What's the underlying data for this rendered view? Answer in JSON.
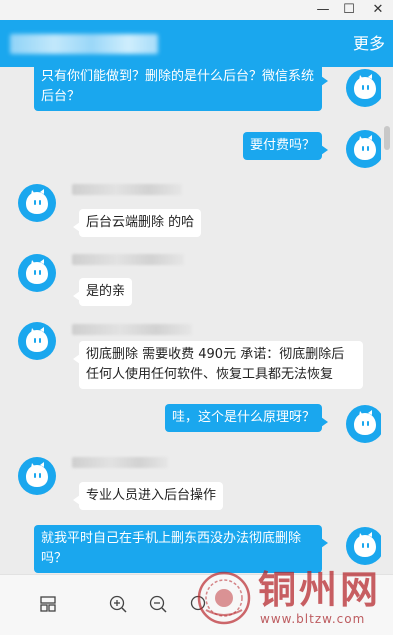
{
  "window": {
    "minimize": "—",
    "maximize": "☐",
    "close": "✕"
  },
  "header": {
    "more_label": "更多"
  },
  "messages": [
    {
      "side": "out",
      "text": "只有你们能做到？删除的是什么后台？微信系统后台？"
    },
    {
      "side": "out",
      "text": "要付费吗？"
    },
    {
      "side": "in",
      "text": "后台云端删除 的哈"
    },
    {
      "side": "in",
      "text": "是的亲"
    },
    {
      "side": "in",
      "text": "彻底删除 需要收费 490元 承诺：彻底删除后任何人使用任何软件、恢复工具都无法恢复"
    },
    {
      "side": "out",
      "text": "哇，这个是什么原理呀？"
    },
    {
      "side": "in",
      "text": "专业人员进入后台操作"
    },
    {
      "side": "out",
      "text": "就我平时自己在手机上删东西没办法彻底删除吗？"
    }
  ],
  "watermark": {
    "name": "铜州网",
    "url": "www.bltzw.com"
  },
  "colors": {
    "accent": "#1aa7ee",
    "incoming": "#ffffff",
    "background": "#ececec"
  }
}
